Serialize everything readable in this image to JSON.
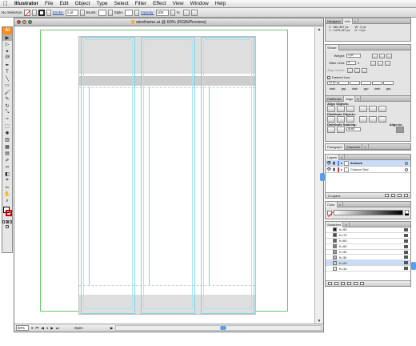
{
  "menubar": {
    "apple": "",
    "items": [
      "Illustrator",
      "File",
      "Edit",
      "Object",
      "Type",
      "Select",
      "Filter",
      "Effect",
      "View",
      "Window",
      "Help"
    ]
  },
  "controlbar": {
    "selection": "No Selection",
    "stroke_label": "Stroke:",
    "stroke_value": "1 pt",
    "brush_label": "Brush:",
    "style_label": "Style:",
    "opacity_label": "Opacity:",
    "opacity_value": "100",
    "percent": "%"
  },
  "tools": {
    "logo": "Ai",
    "icons": [
      "selection-tool-icon",
      "direct-selection-tool-icon",
      "magic-wand-tool-icon",
      "lasso-tool-icon",
      "pen-tool-icon",
      "type-tool-icon",
      "line-tool-icon",
      "rectangle-tool-icon",
      "paintbrush-tool-icon",
      "pencil-tool-icon",
      "rotate-tool-icon",
      "scale-tool-icon",
      "warp-tool-icon",
      "free-transform-tool-icon",
      "symbol-sprayer-tool-icon",
      "column-graph-tool-icon",
      "mesh-tool-icon",
      "gradient-tool-icon",
      "eyedropper-tool-icon",
      "blend-tool-icon",
      "live-paint-tool-icon",
      "slice-tool-icon",
      "scissors-tool-icon",
      "hand-tool-icon",
      "zoom-tool-icon"
    ],
    "glyphs": [
      "▶",
      "▷",
      "✦",
      "ᘛ",
      "✒",
      "T",
      "╲",
      "▭",
      "🖌",
      "✎",
      "↻",
      "⤡",
      "≈",
      "⬚",
      "✺",
      "▥",
      "▦",
      "▤",
      "✐",
      "∞",
      "◧",
      "⌗",
      "✂",
      "✋",
      "⌕"
    ]
  },
  "document": {
    "title": "wireframe.ai @ 60% (RGB/Preview)",
    "zoom": "60%",
    "status": "Open",
    "page": "1"
  },
  "panels": {
    "navigator": {
      "tabs": [
        "Navigator",
        "Info",
        "×"
      ],
      "info_lines": [
        "X : 661.367 px",
        "Y : 1475.167 px"
      ],
      "info_wh": [
        "W : 0 px",
        "H : 0 px"
      ]
    },
    "stroke": {
      "tab": "Stroke",
      "weight_label": "Weight:",
      "weight_value": "1 pt",
      "miter_label": "Miter Limit:",
      "miter_value": "4",
      "miter_x": "x",
      "align_label": "Align Stroke:",
      "dashed_label": "Dashed Line",
      "dash_first": "12 pt",
      "dash_labels": [
        "dash",
        "gap",
        "dash",
        "gap",
        "dash",
        "gap"
      ]
    },
    "align": {
      "tabs": [
        "Pathfinder",
        "Align",
        "×"
      ],
      "align_objects": "Align Objects:",
      "distribute_objects": "Distribute Objects:",
      "distribute_spacing": "Distribute Spacing:",
      "align_to": "Align to:",
      "spacing_value": "Auto"
    },
    "paragraph": {
      "tabs": [
        "Paragraph",
        "Character",
        "×"
      ]
    },
    "layers": {
      "tabs": [
        "Layers",
        "×"
      ],
      "rows": [
        {
          "name": "Artwork",
          "color": "#4a8cff",
          "selected": true
        },
        {
          "name": "Column Grid",
          "color": "#e33b3b",
          "selected": false
        }
      ],
      "footer": "2 Layers"
    },
    "color": {
      "tabs": [
        "Color",
        "×"
      ]
    },
    "swatches": {
      "tabs": [
        "Swatches",
        "×"
      ],
      "rows": [
        {
          "name": "K=90",
          "color": "#1a1a1a",
          "selected": false
        },
        {
          "name": "K=70",
          "color": "#4d4d4d",
          "selected": false
        },
        {
          "name": "K=60",
          "color": "#666666",
          "selected": false
        },
        {
          "name": "K=50",
          "color": "#808080",
          "selected": false
        },
        {
          "name": "K=40",
          "color": "#999999",
          "selected": false
        },
        {
          "name": "K=30",
          "color": "#b3b3b3",
          "selected": false
        },
        {
          "name": "K=20",
          "color": "#cccccc",
          "selected": true
        },
        {
          "name": "K=10",
          "color": "#e6e6e6",
          "selected": false
        }
      ]
    }
  }
}
